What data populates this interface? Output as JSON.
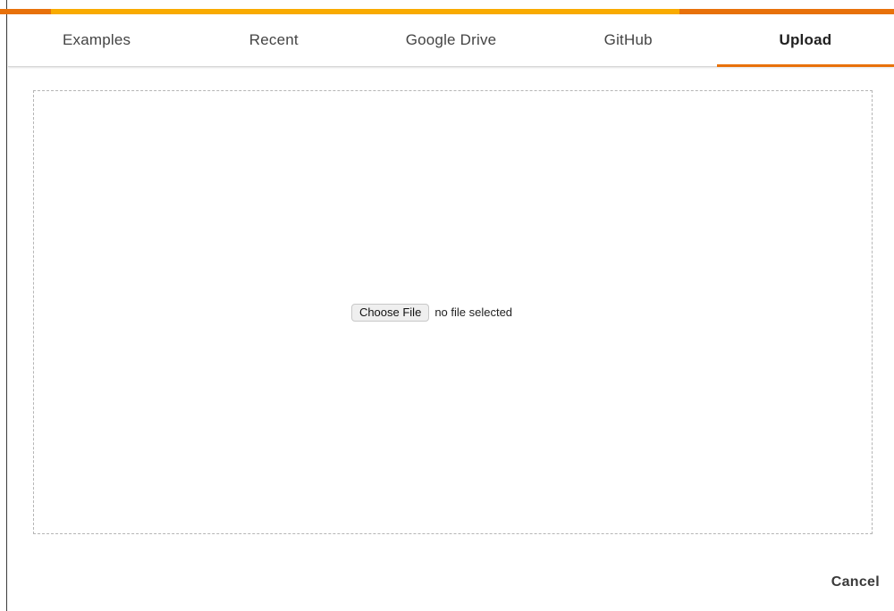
{
  "tabs": [
    {
      "label": "Examples",
      "active": false
    },
    {
      "label": "Recent",
      "active": false
    },
    {
      "label": "Google Drive",
      "active": false
    },
    {
      "label": "GitHub",
      "active": false
    },
    {
      "label": "Upload",
      "active": true
    }
  ],
  "upload": {
    "choose_file_label": "Choose File",
    "file_status": "no file selected"
  },
  "footer": {
    "cancel_label": "Cancel"
  },
  "colors": {
    "accent": "#e8710a",
    "top_bar_orange": "#e8710a",
    "top_bar_amber": "#f9ab00"
  }
}
